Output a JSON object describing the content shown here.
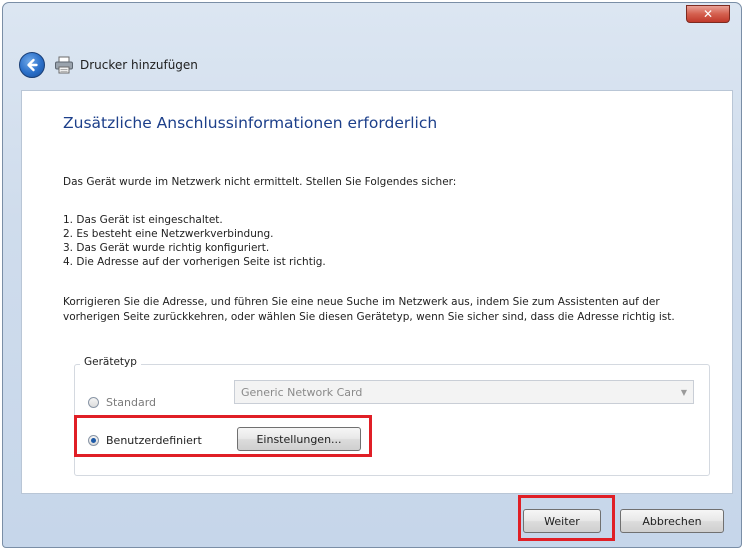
{
  "window": {
    "title": "Drucker hinzufügen",
    "close_label": "✕"
  },
  "page": {
    "heading": "Zusätzliche Anschlussinformationen erforderlich",
    "intro": "Das Gerät wurde im Netzwerk nicht ermittelt. Stellen Sie Folgendes sicher:",
    "steps": [
      "1. Das Gerät ist eingeschaltet.",
      "2. Es besteht eine Netzwerkverbindung.",
      "3. Das Gerät wurde richtig konfiguriert.",
      "4. Die Adresse auf der vorherigen Seite ist richtig."
    ],
    "paragraph": "Korrigieren Sie die Adresse, und führen Sie eine neue Suche im Netzwerk aus, indem Sie zum Assistenten auf der vorherigen Seite zurückkehren, oder wählen Sie diesen Gerätetyp, wenn Sie sicher sind, dass die Adresse richtig ist."
  },
  "device_type": {
    "group_label": "Gerätetyp",
    "standard_label": "Standard",
    "standard_selected": false,
    "standard_value": "Generic Network Card",
    "custom_label": "Benutzerdefiniert",
    "custom_selected": true,
    "settings_button": "Einstellungen..."
  },
  "footer": {
    "next_button": "Weiter",
    "cancel_button": "Abbrechen"
  },
  "colors": {
    "heading": "#1c3f8a",
    "highlight": "#e01f26"
  }
}
